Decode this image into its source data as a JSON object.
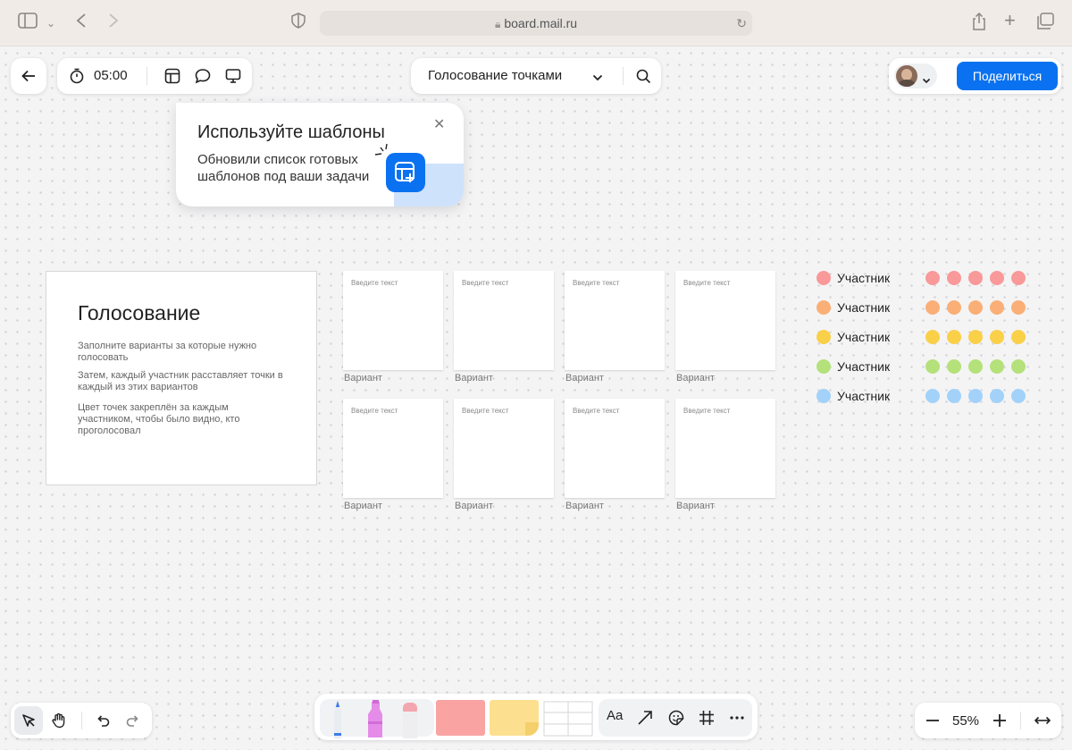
{
  "browser": {
    "url": "board.mail.ru"
  },
  "topbar": {
    "timer": "05:00",
    "board_title": "Голосование точками",
    "share_label": "Поделиться"
  },
  "popup": {
    "title": "Используйте шаблоны",
    "text": "Обновили список готовых шаблонов под ваши задачи"
  },
  "vote_card": {
    "title": "Голосование",
    "paragraphs": [
      "Заполните варианты за которые нужно голосовать",
      "Затем, каждый участник расставляет точки в каждый из этих вариантов",
      "Цвет точек закреплён за каждым участником, чтобы было видно, кто проголосовал"
    ]
  },
  "cards": {
    "placeholder": "Введите текст",
    "label": "Вариант"
  },
  "participants": [
    {
      "name": "Участник",
      "color": "#f59a9a"
    },
    {
      "name": "Участник",
      "color": "#f7b07a"
    },
    {
      "name": "Участник",
      "color": "#f8d04f"
    },
    {
      "name": "Участник",
      "color": "#b5e07e"
    },
    {
      "name": "Участник",
      "color": "#a4d2f7"
    }
  ],
  "bottom_toolbar": {
    "text_tool": "Aa",
    "swatch_colors": [
      "#f9a3a3",
      "#fde08f"
    ]
  },
  "zoom": {
    "level": "55%"
  }
}
